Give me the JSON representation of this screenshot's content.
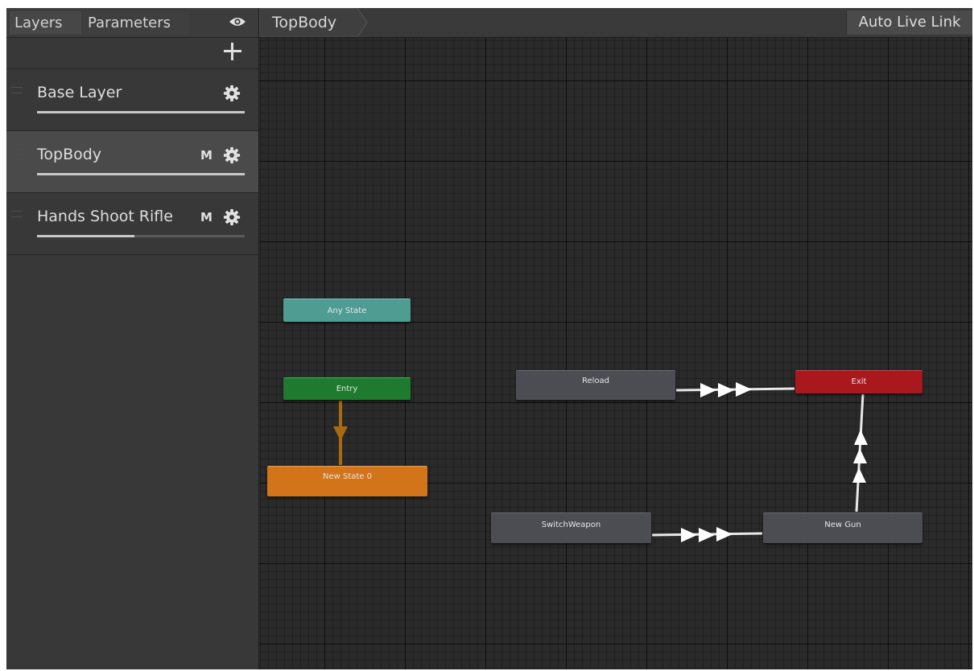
{
  "left_panel": {
    "tabs": [
      "Layers",
      "Parameters"
    ],
    "layers": [
      {
        "name": "Base Layer",
        "badge": "",
        "weight_fraction": 1.0,
        "selected": false
      },
      {
        "name": "TopBody",
        "badge": "M",
        "weight_fraction": 1.0,
        "selected": true
      },
      {
        "name": "Hands Shoot Rifle",
        "badge": "M",
        "weight_fraction": 0.47,
        "selected": false
      }
    ]
  },
  "graph": {
    "breadcrumb": "TopBody",
    "auto_live_link": "Auto Live Link",
    "states": {
      "any_state": "Any State",
      "entry": "Entry",
      "new_state_0": "New State 0",
      "reload": "Reload",
      "exit": "Exit",
      "switch_weapon": "SwitchWeapon",
      "new_gun": "New Gun"
    },
    "colors": {
      "any_state": "#4f9c92",
      "entry": "#1d7a2f",
      "default_state": "#d2741a",
      "state": "#4b4d53",
      "exit": "#a8181c",
      "default_transition": "#a86a10",
      "transition": "#e8e8e8"
    }
  }
}
